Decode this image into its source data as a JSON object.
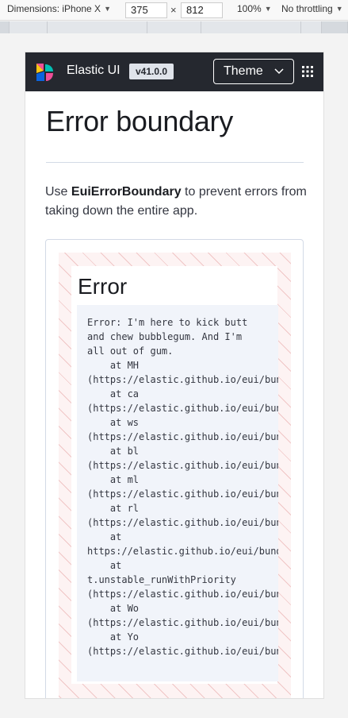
{
  "devtools": {
    "device_label": "Dimensions: iPhone X",
    "width": "375",
    "height": "812",
    "times": "×",
    "zoom": "100%",
    "throttle": "No throttling"
  },
  "header": {
    "brand": "Elastic UI",
    "version": "v41.0.0",
    "theme_label": "Theme"
  },
  "page": {
    "title": "Error boundary",
    "desc_prefix": "Use ",
    "desc_component": "EuiErrorBoundary",
    "desc_suffix": " to prevent errors from taking down the entire app."
  },
  "error": {
    "title": "Error",
    "stack": "Error: I'm here to kick butt\nand chew bubblegum. And I'm\nall out of gum.\n    at MH\n(https://elastic.github.io/eui/bundl\n    at ca\n(https://elastic.github.io/eui/bundl\n    at ws\n(https://elastic.github.io/eui/bundl\n    at bl\n(https://elastic.github.io/eui/bundl\n    at ml\n(https://elastic.github.io/eui/bundl\n    at rl\n(https://elastic.github.io/eui/bundl\n    at\nhttps://elastic.github.io/eui/bundle\n    at\nt.unstable_runWithPriority\n(https://elastic.github.io/eui/bundl\n    at Wo\n(https://elastic.github.io/eui/bundl\n    at Yo\n(https://elastic.github.io/eui/bundl"
  },
  "colors": {
    "header_bg": "#25282f",
    "boundary_stripe": "#f0c6c6",
    "code_bg": "#f1f4fa"
  },
  "icons": {
    "logo": "elastic-logo-icon",
    "dropdown": "chevron-down-icon",
    "apps": "apps-grid-icon",
    "select": "triangle-down-icon"
  }
}
